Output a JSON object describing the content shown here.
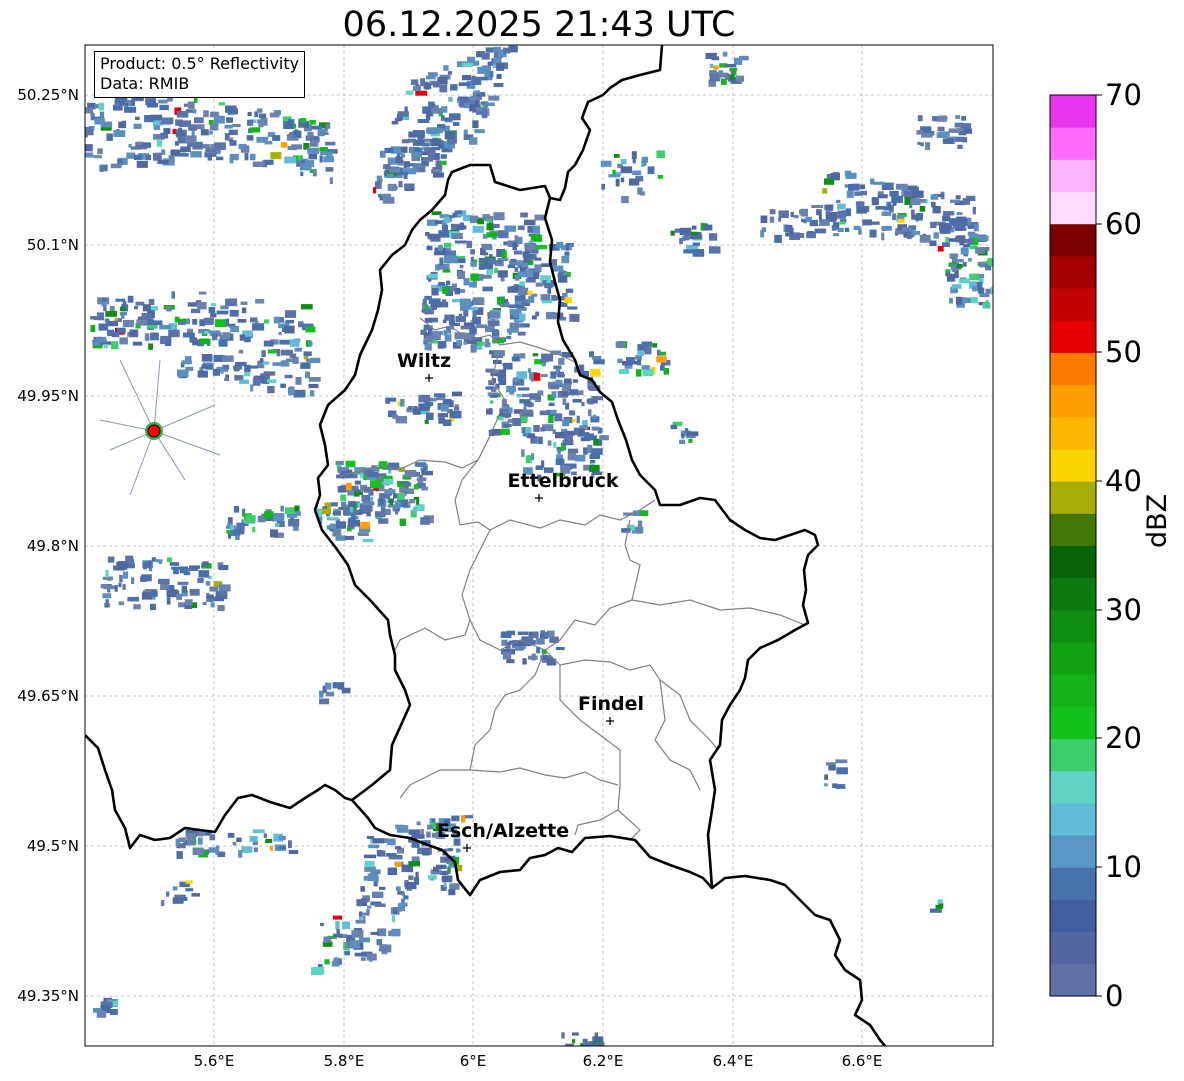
{
  "title": "06.12.2025 21:43 UTC",
  "info": {
    "product": "Product: 0.5° Reflectivity",
    "data": "Data: RMIB"
  },
  "lat_labels": [
    "50.25°N",
    "50.1°N",
    "49.95°N",
    "49.8°N",
    "49.65°N",
    "49.5°N",
    "49.35°N"
  ],
  "lon_labels": [
    "5.6°E",
    "5.8°E",
    "6°E",
    "6.2°E",
    "6.4°E",
    "6.6°E"
  ],
  "cities": [
    {
      "name": "Wiltz"
    },
    {
      "name": "Ettelbruck"
    },
    {
      "name": "Findel"
    },
    {
      "name": "Esch/Alzette"
    }
  ],
  "colorbar": {
    "label": "dBZ",
    "ticks": [
      "0",
      "10",
      "20",
      "30",
      "40",
      "50",
      "60",
      "70"
    ],
    "colors": [
      "#5f72a6",
      "#5267a0",
      "#425ea2",
      "#4772ad",
      "#5a97c4",
      "#62bcd8",
      "#5fd4c4",
      "#3ecf6d",
      "#13c11d",
      "#12b419",
      "#11a314",
      "#0f8e12",
      "#0c7a0f",
      "#096309",
      "#417808",
      "#a7ae07",
      "#fdd500",
      "#fcb800",
      "#fe9e00",
      "#fe7b01",
      "#e40000",
      "#c10000",
      "#a30000",
      "#7b0000",
      "#ffdcff",
      "#ffb3ff",
      "#ff6cfc",
      "#ea35ee"
    ]
  },
  "radar_site": {
    "color": "#ff0000"
  }
}
